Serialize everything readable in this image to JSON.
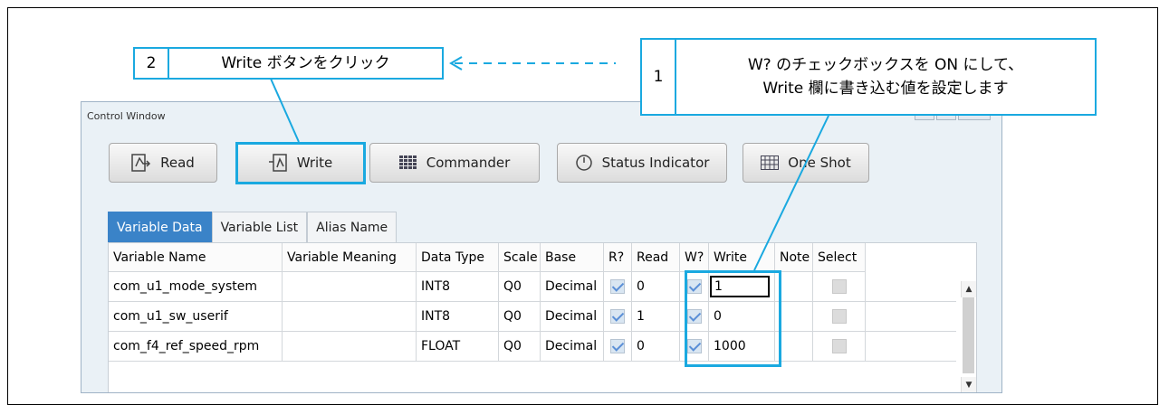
{
  "callout1": {
    "number": "1",
    "line1": "W? のチェックボックスを ON にして、",
    "line2": "Write 欄に書き込む値を設定します"
  },
  "callout2": {
    "number": "2",
    "text": "Write ボタンをクリック"
  },
  "window": {
    "title": "Control Window",
    "controls": [
      "minimize-icon",
      "maximize-icon",
      "close-icon"
    ],
    "toolbar": [
      {
        "label": "Read",
        "icon": "read-icon"
      },
      {
        "label": "Write",
        "icon": "write-icon"
      },
      {
        "label": "Commander",
        "icon": "commander-icon"
      },
      {
        "label": "Status Indicator",
        "icon": "status-indicator-icon"
      },
      {
        "label": "One Shot",
        "icon": "one-shot-icon"
      }
    ],
    "tabs": [
      "Variable Data",
      "Variable List",
      "Alias Name"
    ],
    "active_tab": "Variable Data",
    "columns": [
      "Variable Name",
      "Variable Meaning",
      "Data Type",
      "Scale",
      "Base",
      "R?",
      "Read",
      "W?",
      "Write",
      "Note",
      "Select"
    ],
    "rows": [
      {
        "name": "com_u1_mode_system",
        "meaning": "",
        "type": "INT8",
        "scale": "Q0",
        "base": "Decimal",
        "r": true,
        "read": "0",
        "w": true,
        "write": "1",
        "note": "",
        "select": false
      },
      {
        "name": "com_u1_sw_userif",
        "meaning": "",
        "type": "INT8",
        "scale": "Q0",
        "base": "Decimal",
        "r": true,
        "read": "1",
        "w": true,
        "write": "0",
        "note": "",
        "select": false
      },
      {
        "name": "com_f4_ref_speed_rpm",
        "meaning": "",
        "type": "FLOAT",
        "scale": "Q0",
        "base": "Decimal",
        "r": true,
        "read": "0",
        "w": true,
        "write": "1000",
        "note": "",
        "select": false
      }
    ]
  },
  "colors": {
    "accent": "#1aa9e0",
    "tab_active": "#3a83c8",
    "checkbox": "#5b8fd6"
  }
}
